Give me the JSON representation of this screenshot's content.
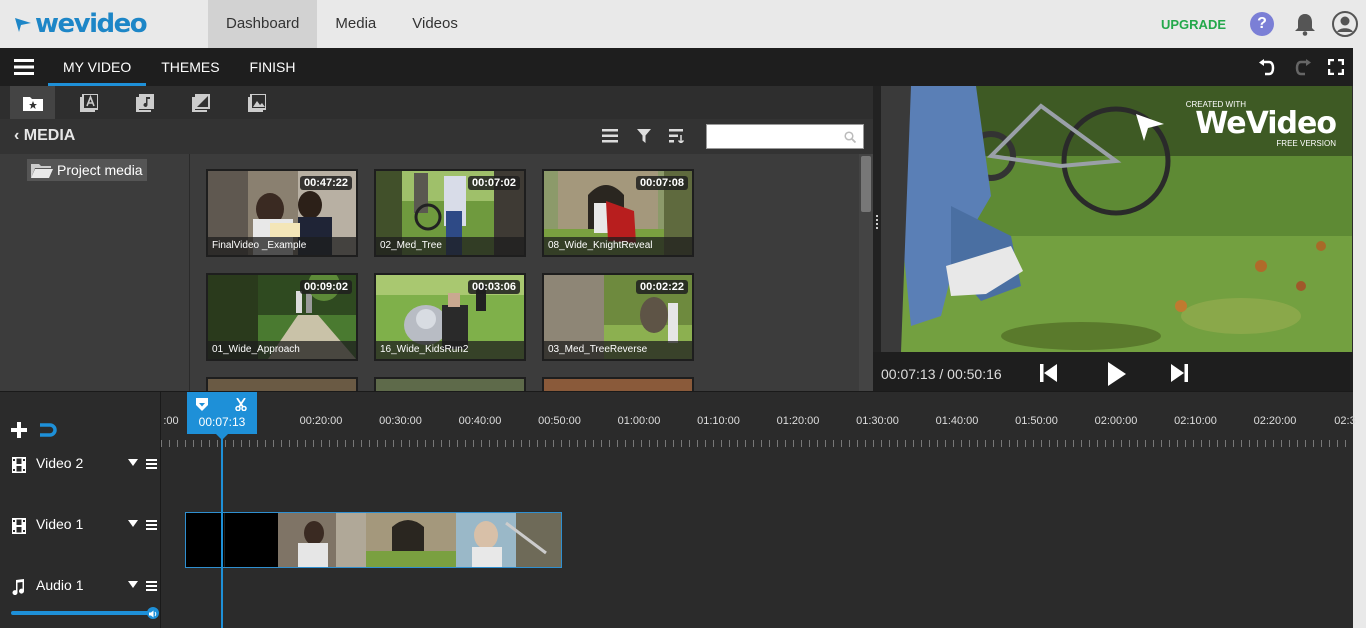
{
  "app": {
    "logo_text": "wevideo"
  },
  "topnav": {
    "tabs": [
      {
        "label": "Dashboard"
      },
      {
        "label": "Media"
      },
      {
        "label": "Videos"
      }
    ],
    "upgrade": "UPGRADE",
    "help": "?"
  },
  "subnav": {
    "tabs": [
      {
        "label": "MY VIDEO"
      },
      {
        "label": "THEMES"
      },
      {
        "label": "FINISH"
      }
    ]
  },
  "media": {
    "title": "MEDIA",
    "search_placeholder": "",
    "folder": "Project media",
    "clips": [
      {
        "name": "FinalVideo _Example",
        "duration": "00:47:22"
      },
      {
        "name": "02_Med_Tree",
        "duration": "00:07:02"
      },
      {
        "name": "08_Wide_KnightReveal",
        "duration": "00:07:08"
      },
      {
        "name": "01_Wide_Approach",
        "duration": "00:09:02"
      },
      {
        "name": "16_Wide_KidsRun2",
        "duration": "00:03:06"
      },
      {
        "name": "03_Med_TreeReverse",
        "duration": "00:02:22"
      }
    ]
  },
  "preview": {
    "watermark_small": "CREATED WITH",
    "watermark_big": "WeVideo",
    "watermark_sub": "FREE VERSION",
    "timecode": "00:07:13 / 00:50:16"
  },
  "timeline": {
    "playhead": "00:07:13",
    "ruler": [
      "00:20:00",
      "00:30:00",
      "00:40:00",
      "00:50:00",
      "01:00:00",
      "01:10:00",
      "01:20:00",
      "01:30:00",
      "01:40:00",
      "01:50:00",
      "02:00:00",
      "02:10:00",
      "02:20:00"
    ],
    "ruler_partial_left": ":00",
    "ruler_partial_right": "02:3",
    "tracks": [
      {
        "name": "Video 2"
      },
      {
        "name": "Video 1"
      },
      {
        "name": "Audio 1"
      }
    ],
    "audio_volume": 1.0
  },
  "colors": {
    "accent": "#1e90d8",
    "upgrade": "#23a84a",
    "help": "#7b7fd6"
  }
}
